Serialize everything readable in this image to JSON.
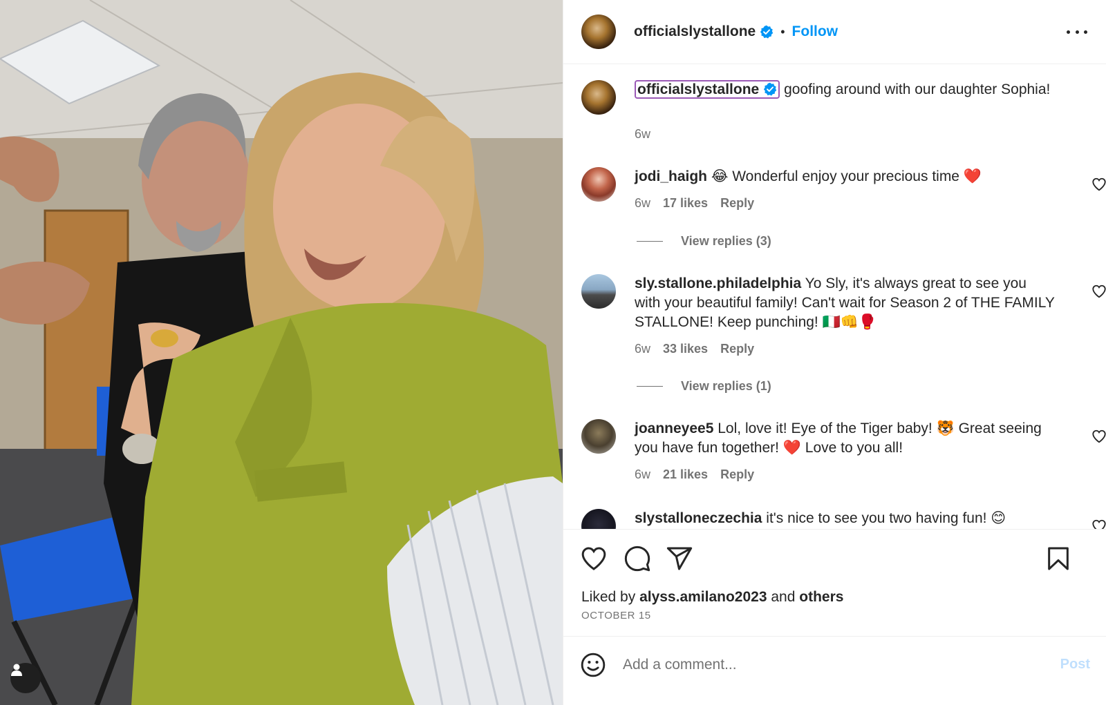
{
  "post": {
    "author": "officialslystallone",
    "follow_label": "Follow",
    "separator": "•"
  },
  "caption": {
    "username": "officialslystallone",
    "text": "goofing around with our daughter Sophia!",
    "time": "6w"
  },
  "comments": [
    {
      "username": "jodi_haigh",
      "text": "😂 Wonderful enjoy your precious time ❤️",
      "time": "6w",
      "likes": "17 likes",
      "reply_label": "Reply",
      "view_replies": "View replies (3)"
    },
    {
      "username": "sly.stallone.philadelphia",
      "text": "Yo Sly, it's always great to see you with your beautiful family! Can't wait for Season 2 of THE FAMILY STALLONE! Keep punching! 🇮🇹👊🥊",
      "time": "6w",
      "likes": "33 likes",
      "reply_label": "Reply",
      "view_replies": "View replies (1)"
    },
    {
      "username": "joanneyee5",
      "text": "Lol, love it! Eye of the Tiger baby! 🐯 Great seeing you have fun together! ❤️ Love to you all!",
      "time": "6w",
      "likes": "21 likes",
      "reply_label": "Reply"
    },
    {
      "username": "slystalloneczechia",
      "text": "it's nice to see you two having fun! 😊"
    }
  ],
  "actions": {
    "liked_by_prefix": "Liked by",
    "liked_by_user": "alyss.amilano2023",
    "liked_by_and": "and",
    "liked_by_others": "others",
    "date": "OCTOBER 15"
  },
  "add_comment": {
    "placeholder": "Add a comment...",
    "post_label": "Post"
  },
  "colors": {
    "link_blue": "#0095f6",
    "verified_blue": "#0095f6",
    "post_disabled": "#c0dffd",
    "muted_text": "#737373",
    "caption_highlight": "#9b59b6"
  },
  "icons": [
    "verified-icon",
    "more-options-icon",
    "heart-icon",
    "comment-icon",
    "share-icon",
    "bookmark-icon",
    "emoji-icon",
    "user-tag-icon"
  ]
}
